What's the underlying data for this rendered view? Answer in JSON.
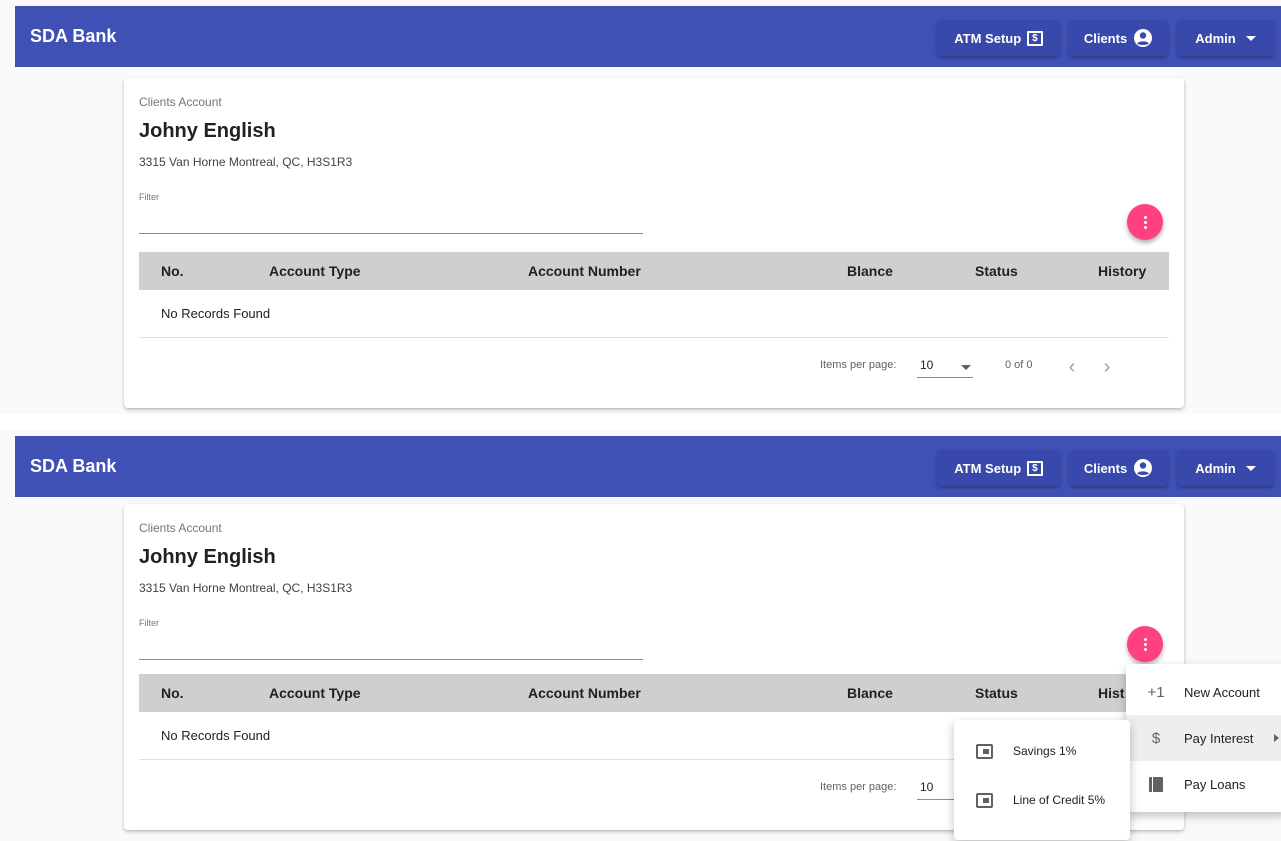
{
  "app": {
    "brand": "SDA Bank",
    "nav": {
      "atm_label": "ATM Setup",
      "atm_icon_text": "$",
      "clients_label": "Clients",
      "admin_label": "Admin"
    }
  },
  "client": {
    "breadcrumb": "Clients Account",
    "name": "Johny English",
    "address": "3315 Van Horne Montreal, QC, H3S1R3"
  },
  "filter": {
    "label": "Filter",
    "value": ""
  },
  "table": {
    "columns": [
      "No.",
      "Account Type",
      "Account Number",
      "Blance",
      "Status",
      "History"
    ],
    "columns_truncated": [
      "No.",
      "Account Type",
      "Account Number",
      "Blance",
      "Status",
      "Hist"
    ],
    "empty_message": "No Records Found"
  },
  "paginator": {
    "items_per_page_label": "Items per page:",
    "items_per_page": "10",
    "range": "0 of 0",
    "prev_glyph": "‹",
    "next_glyph": "›"
  },
  "menu": {
    "items": [
      {
        "icon_text": "+1",
        "label": "New Account"
      },
      {
        "icon_text": "$",
        "label": "Pay Interest"
      },
      {
        "label": "Pay Loans"
      }
    ],
    "submenu": [
      {
        "label": "Savings 1%"
      },
      {
        "label": "Line of Credit 5%"
      }
    ]
  },
  "colors": {
    "toolbar": "#3f51b5",
    "nav_button": "#3949ab",
    "fab": "#ff4081",
    "table_header": "#cfcfcf"
  },
  "icons": {
    "atm": "dollar-box-icon",
    "clients": "account-circle-icon",
    "admin": "arrow-drop-down-icon",
    "fab": "more-vert-icon",
    "new_account": "plus-one-icon",
    "pay_interest": "dollar-icon",
    "pay_loans": "book-icon",
    "submenu": "wallet-icon"
  }
}
